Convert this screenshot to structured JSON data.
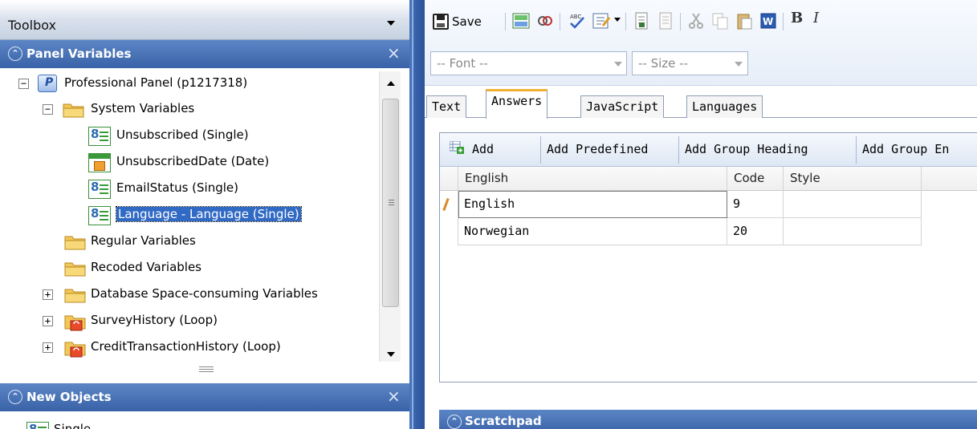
{
  "toolbox": {
    "title": "Toolbox"
  },
  "panel_variables": {
    "title": "Panel Variables",
    "tree": [
      {
        "label": "Professional Panel (p1217318)",
        "expander": "−"
      },
      {
        "label": "System Variables",
        "expander": "−"
      },
      {
        "label": "Unsubscribed (Single)"
      },
      {
        "label": "UnsubscribedDate (Date)"
      },
      {
        "label": "EmailStatus (Single)"
      },
      {
        "label": "Language - Language (Single)"
      },
      {
        "label": "Regular Variables"
      },
      {
        "label": "Recoded Variables"
      },
      {
        "label": "Database Space-consuming Variables",
        "expander": "+"
      },
      {
        "label": "SurveyHistory (Loop)",
        "expander": "+"
      },
      {
        "label": "CreditTransactionHistory (Loop)",
        "expander": "+"
      }
    ]
  },
  "new_objects": {
    "title": "New Objects",
    "items": [
      {
        "label": "Single"
      }
    ]
  },
  "editor": {
    "save_label": "Save",
    "bold_label": "B",
    "italic_label": "I",
    "font_placeholder": "-- Font --",
    "size_placeholder": "-- Size --"
  },
  "tabs": [
    {
      "label": "Text"
    },
    {
      "label": "Answers"
    },
    {
      "label": "JavaScript"
    },
    {
      "label": "Languages"
    }
  ],
  "answers_toolbar": {
    "add": "Add",
    "add_predefined": "Add Predefined",
    "add_group_heading": "Add Group Heading",
    "add_group_end": "Add Group En"
  },
  "grid": {
    "headers": [
      "English",
      "Code",
      "Style"
    ],
    "rows": [
      {
        "english": "English",
        "code": "9",
        "style": ""
      },
      {
        "english": "Norwegian",
        "code": "20",
        "style": ""
      }
    ]
  },
  "scratchpad": {
    "title": "Scratchpad"
  },
  "colors": {
    "panel_header": "#3a62a8",
    "selection": "#316ac5",
    "active_tab_accent": "#f0b030"
  }
}
